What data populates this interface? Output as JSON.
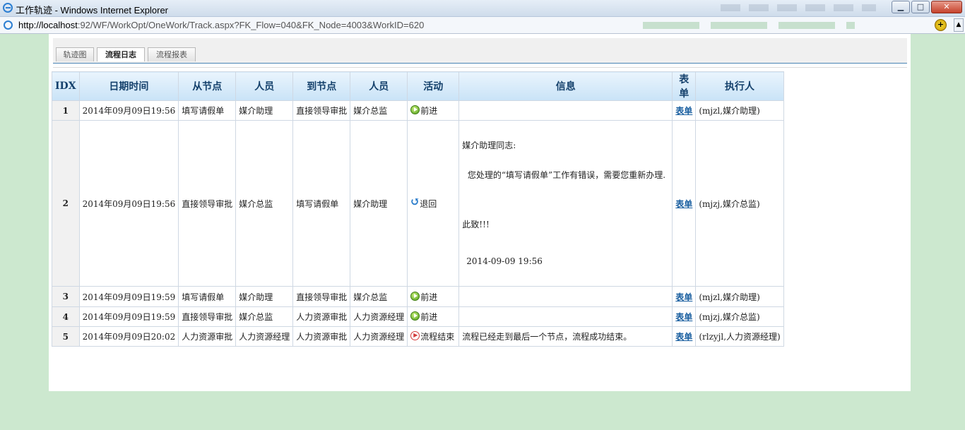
{
  "window": {
    "title": "工作轨迹 - Windows Internet Explorer",
    "address_host": "http://localhost",
    "address_rest": ":92/WF/WorkOpt/OneWork/Track.aspx?FK_Flow=040&FK_Node=4003&WorkID=620"
  },
  "tabs": [
    {
      "label": "轨迹图",
      "active": false
    },
    {
      "label": "流程日志",
      "active": true
    },
    {
      "label": "流程报表",
      "active": false
    }
  ],
  "table": {
    "headers": [
      "IDX",
      "日期时间",
      "从节点",
      "人员",
      "到节点",
      "人员",
      "活动",
      "信息",
      "表单",
      "执行人"
    ],
    "rows": [
      {
        "idx": "1",
        "datetime": "2014年09月09日19:56",
        "from_node": "填写请假单",
        "from_person": "媒介助理",
        "to_node": "直接领导审批",
        "to_person": "媒介总监",
        "activity": "前进",
        "activity_icon": "forward-icon",
        "info_lines": [],
        "info_time": "",
        "form": "表单",
        "executor": "(mjzl,媒介助理)"
      },
      {
        "idx": "2",
        "datetime": "2014年09月09日19:56",
        "from_node": "直接领导审批",
        "from_person": "媒介总监",
        "to_node": "填写请假单",
        "to_person": "媒介助理",
        "activity": "退回",
        "activity_icon": "return-icon",
        "info_lines": [
          "媒介助理同志:",
          "  您处理的“填写请假单”工作有错误，需要您重新办理.",
          "",
          "此致!!!"
        ],
        "info_time": "2014-09-09 19:56",
        "form": "表单",
        "executor": "(mjzj,媒介总监)"
      },
      {
        "idx": "3",
        "datetime": "2014年09月09日19:59",
        "from_node": "填写请假单",
        "from_person": "媒介助理",
        "to_node": "直接领导审批",
        "to_person": "媒介总监",
        "activity": "前进",
        "activity_icon": "forward-icon",
        "info_lines": [],
        "info_time": "",
        "form": "表单",
        "executor": "(mjzl,媒介助理)"
      },
      {
        "idx": "4",
        "datetime": "2014年09月09日19:59",
        "from_node": "直接领导审批",
        "from_person": "媒介总监",
        "to_node": "人力资源审批",
        "to_person": "人力资源经理",
        "activity": "前进",
        "activity_icon": "forward-icon",
        "info_lines": [],
        "info_time": "",
        "form": "表单",
        "executor": "(mjzj,媒介总监)"
      },
      {
        "idx": "5",
        "datetime": "2014年09月09日20:02",
        "from_node": "人力资源审批",
        "from_person": "人力资源经理",
        "to_node": "人力资源审批",
        "to_person": "人力资源经理",
        "activity": "流程结束",
        "activity_icon": "flow-end-icon",
        "info_lines": [
          "流程已经走到最后一个节点，流程成功结束。"
        ],
        "info_time": "",
        "form": "表单",
        "executor": "(rlzyjl,人力资源经理)"
      }
    ]
  },
  "colors": {
    "page_background": "#cce8cf",
    "header_text": "#15416c",
    "link": "#1a5fa0"
  }
}
